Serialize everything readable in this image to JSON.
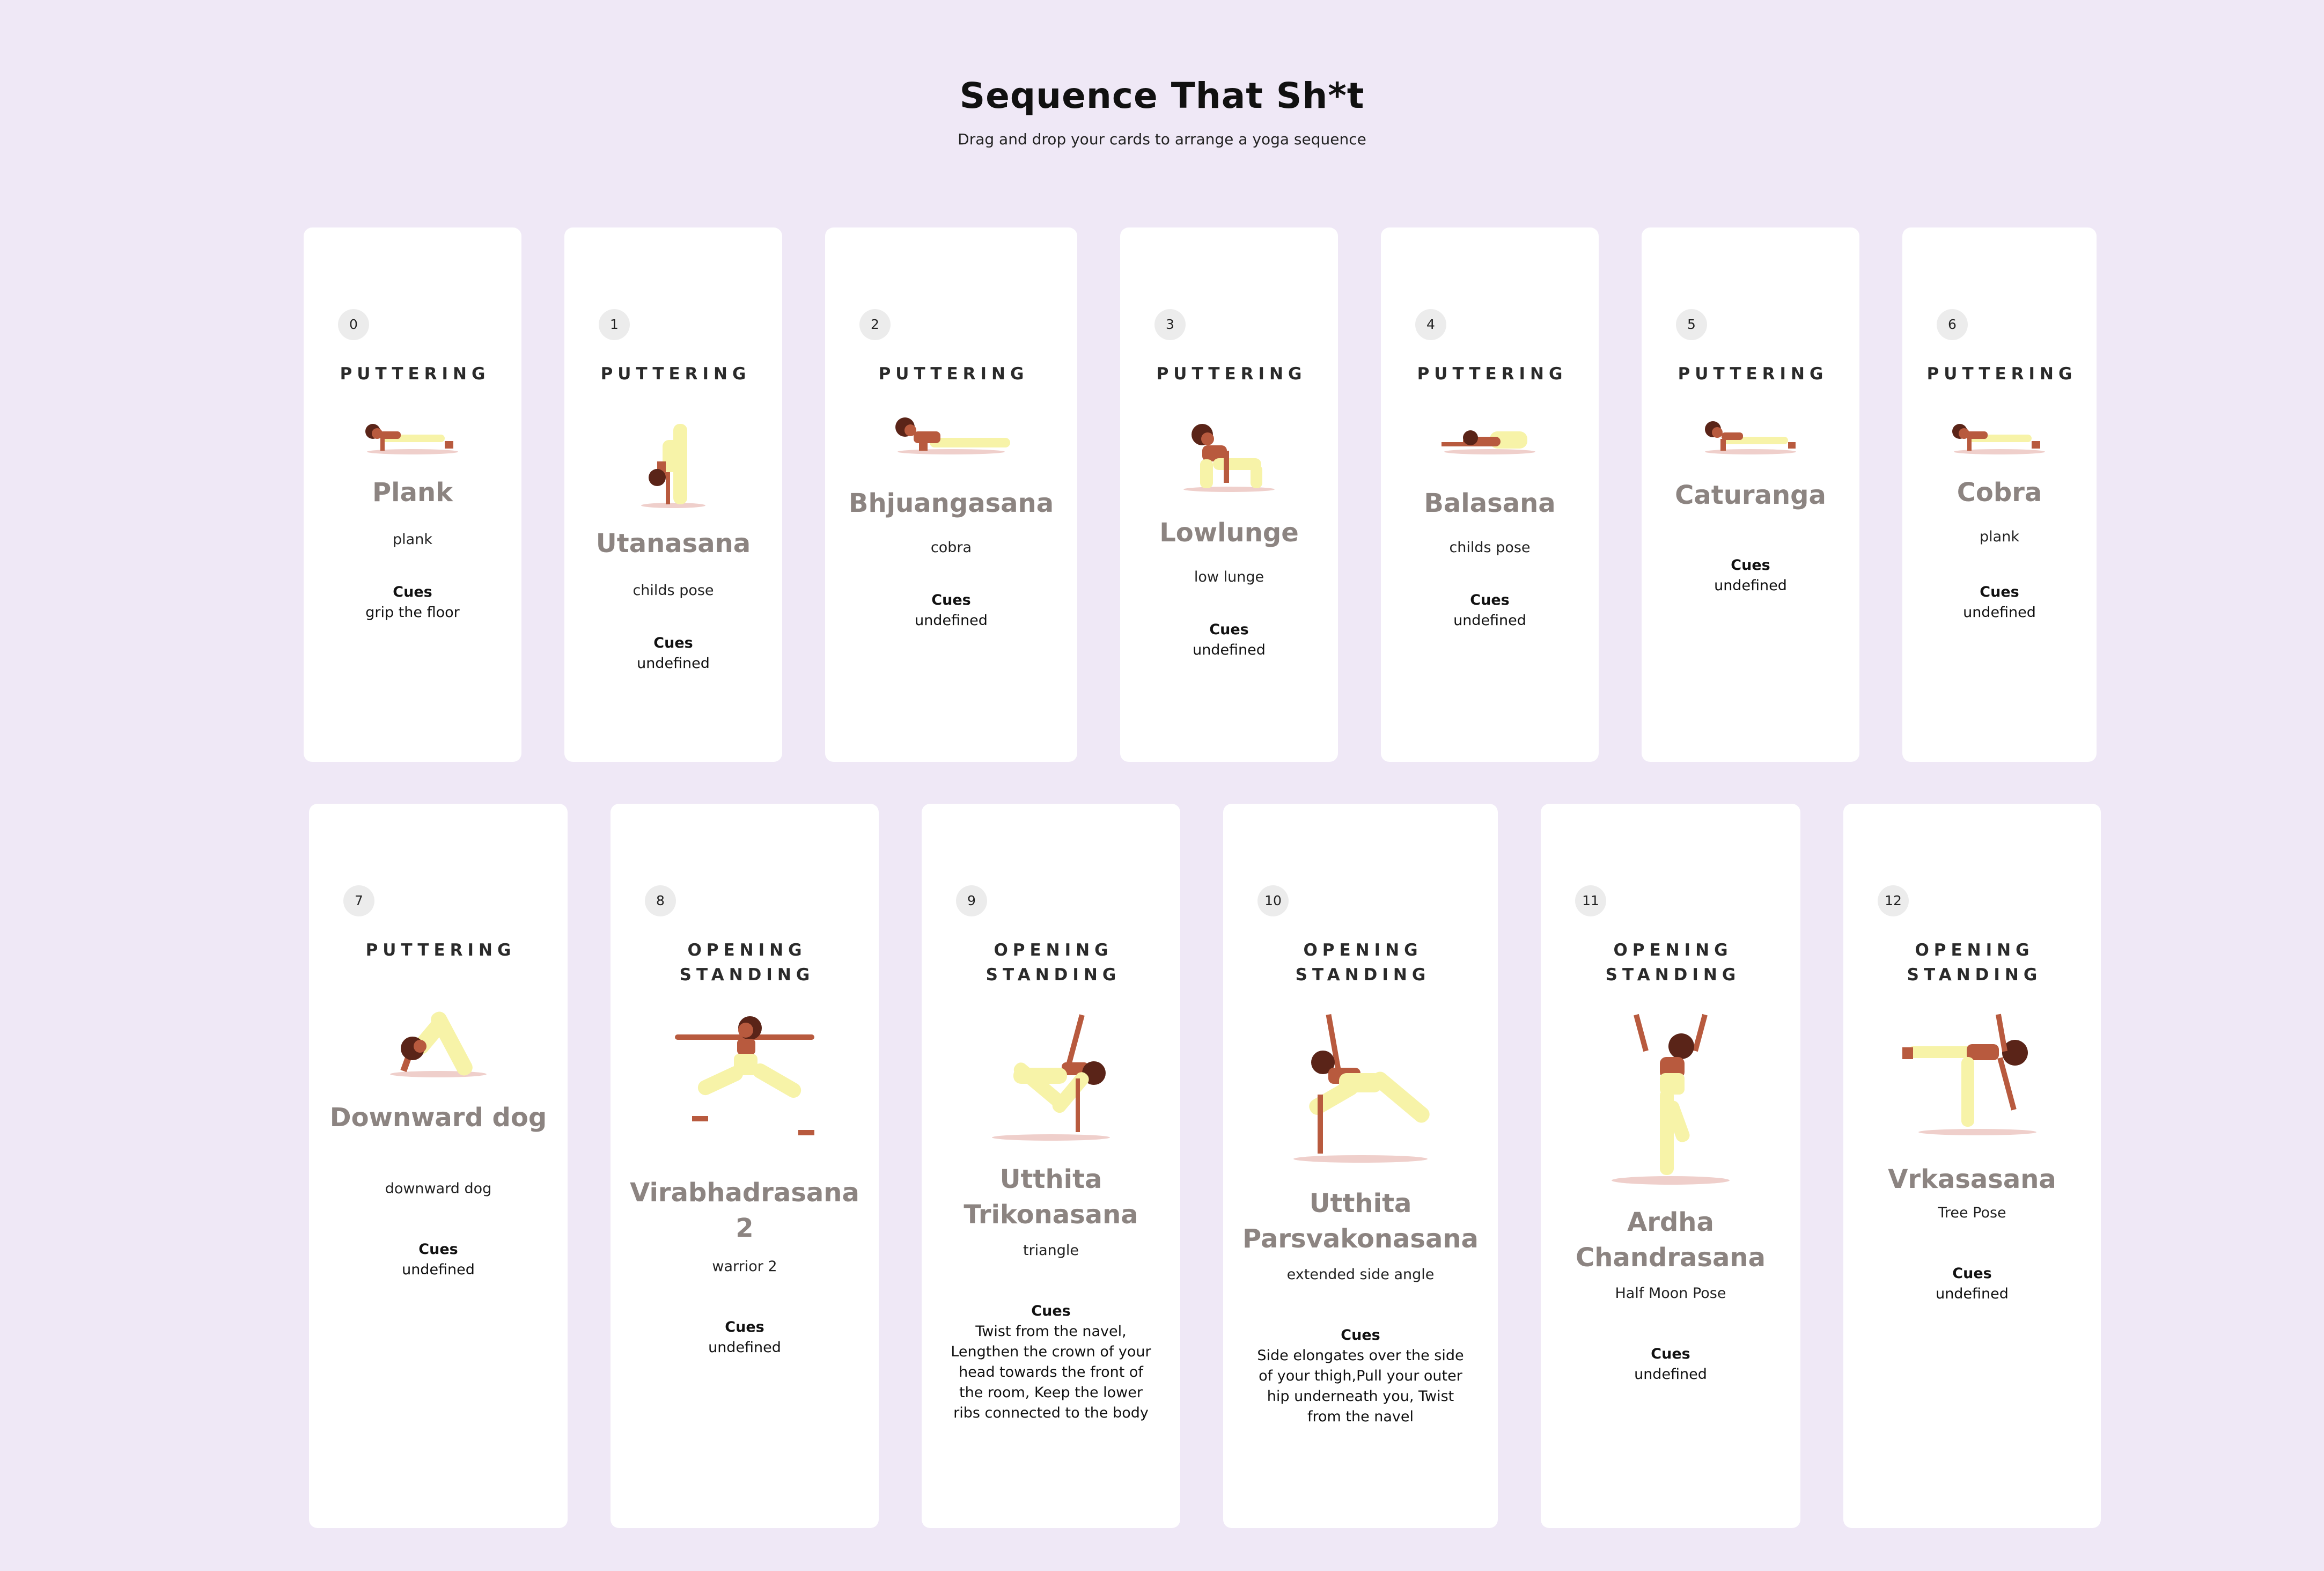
{
  "header": {
    "title": "Sequence That Sh*t",
    "subtitle": "Drag and drop your cards to arrange a yoga sequence"
  },
  "cues_label": "Cues",
  "colors": {
    "background": "#efe8f6",
    "card": "#ffffff",
    "skin": "#b85a3e",
    "hair": "#5a2418",
    "outfit": "#f7f3a8",
    "shadow": "#efcfcb",
    "pose_name": "#8c8481"
  },
  "cards": [
    {
      "index": "0",
      "category": "PUTTERING",
      "name": "Plank",
      "subtitle": "plank",
      "cues": "grip the floor",
      "icon": "plank-figure-icon"
    },
    {
      "index": "1",
      "category": "PUTTERING",
      "name": "Utanasana",
      "subtitle": "childs pose",
      "cues": "undefined",
      "icon": "forward-fold-figure-icon"
    },
    {
      "index": "2",
      "category": "PUTTERING",
      "name": "Bhjuangasana",
      "subtitle": "cobra",
      "cues": "undefined",
      "icon": "cobra-figure-icon"
    },
    {
      "index": "3",
      "category": "PUTTERING",
      "name": "Lowlunge",
      "subtitle": "low lunge",
      "cues": "undefined",
      "icon": "low-lunge-figure-icon"
    },
    {
      "index": "4",
      "category": "PUTTERING",
      "name": "Balasana",
      "subtitle": "childs pose",
      "cues": "undefined",
      "icon": "childs-pose-figure-icon"
    },
    {
      "index": "5",
      "category": "PUTTERING",
      "name": "Caturanga",
      "subtitle": "",
      "cues": "undefined",
      "icon": "chaturanga-figure-icon"
    },
    {
      "index": "6",
      "category": "PUTTERING",
      "name": "Cobra",
      "subtitle": "plank",
      "cues": "undefined",
      "icon": "plank-figure-icon"
    },
    {
      "index": "7",
      "category": "PUTTERING",
      "name": "Downward dog",
      "subtitle": "downward dog",
      "cues": "undefined",
      "icon": "downward-dog-figure-icon"
    },
    {
      "index": "8",
      "category": "OPENING STANDING",
      "name": "Virabhadrasana 2",
      "subtitle": "warrior 2",
      "cues": "undefined",
      "icon": "warrior-two-figure-icon"
    },
    {
      "index": "9",
      "category": "OPENING STANDING",
      "name": "Utthita Trikonasana",
      "subtitle": "triangle",
      "cues": "Twist from the navel, Lengthen the crown of your head towards the front of the room, Keep the lower ribs connected to the body",
      "icon": "triangle-figure-icon"
    },
    {
      "index": "10",
      "category": "OPENING STANDING",
      "name": "Utthita Parsvakonasana",
      "subtitle": "extended side angle",
      "cues": "Side elongates over the side of your thigh,Pull your outer hip underneath you, Twist from the navel",
      "icon": "side-angle-figure-icon"
    },
    {
      "index": "11",
      "category": "OPENING STANDING",
      "name": "Ardha Chandrasana",
      "subtitle": "Half Moon Pose",
      "cues": "undefined",
      "icon": "half-moon-figure-icon"
    },
    {
      "index": "12",
      "category": "OPENING STANDING",
      "name": "Vrkasasana",
      "subtitle": "Tree Pose",
      "cues": "undefined",
      "icon": "tree-pose-figure-icon"
    }
  ]
}
